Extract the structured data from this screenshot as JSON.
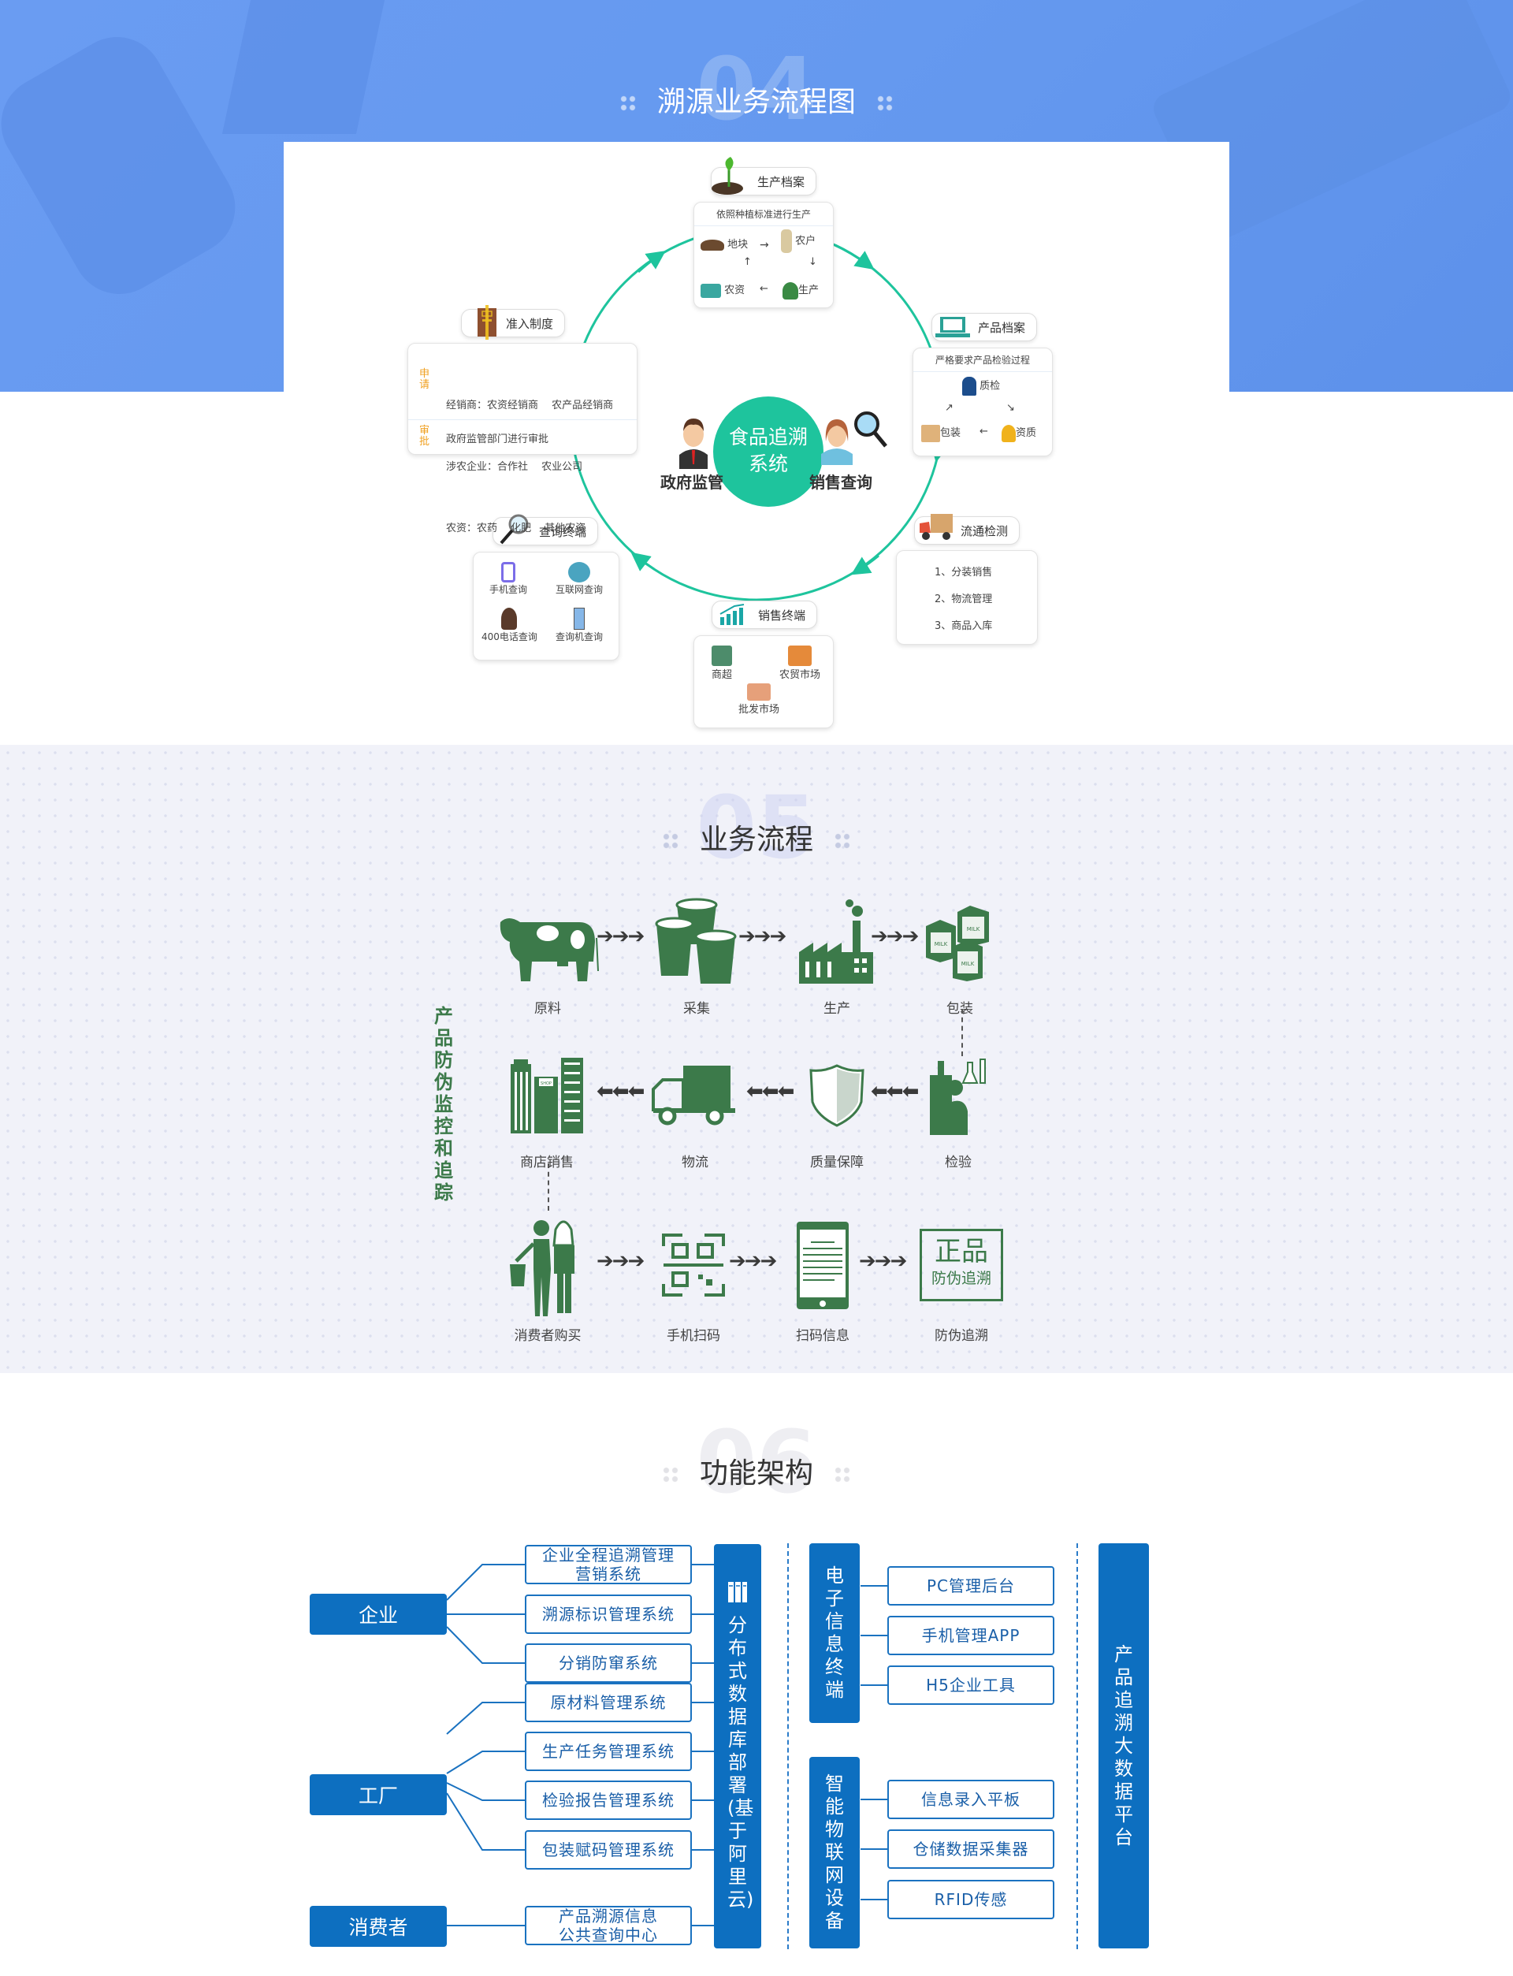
{
  "section1": {
    "number": "04",
    "title": "溯源业务流程图",
    "center": {
      "line1": "食品追溯",
      "line2": "系统"
    },
    "left_person": "政府监管",
    "right_person": "销售查询",
    "colors": {
      "ring": "#1ec49d",
      "accent_orange": "#f0a020"
    },
    "production": {
      "title": "生产档案",
      "header": "依照种植标准进行生产",
      "items": [
        "地块",
        "农户",
        "生产",
        "农资"
      ]
    },
    "product": {
      "title": "产品档案",
      "header": "严格要求产品检验过程",
      "items": [
        "质检",
        "资质",
        "包装"
      ]
    },
    "circulation": {
      "title": "流通检测",
      "items": [
        "1、分装销售",
        "2、物流管理",
        "3、商品入库"
      ]
    },
    "sales": {
      "title": "销售终端",
      "items": [
        "商超",
        "农贸市场",
        "批发市场"
      ]
    },
    "query": {
      "title": "查询终端",
      "items": [
        "手机查询",
        "互联网查询",
        "400电话查询",
        "查询机查询"
      ]
    },
    "access": {
      "title": "准入制度",
      "apply_label": "申请",
      "apply_lines": [
        "经销商：农资经销商　 农产品经销商",
        "涉农企业：合作社　 农业公司",
        "农资：农药　 化肥　 其他农资"
      ],
      "approve_label": "审批",
      "approve_line": "政府监管部门进行审批"
    }
  },
  "section2": {
    "number": "05",
    "title": "业务流程",
    "side_title": "产品防伪监控和追踪",
    "color": "#3c7a4a",
    "row1": [
      "原料",
      "采集",
      "生产",
      "包装"
    ],
    "row2": [
      "商店销售",
      "物流",
      "质量保障",
      "检验"
    ],
    "row3": [
      "消费者购买",
      "手机扫码",
      "扫码信息",
      "防伪追溯"
    ],
    "stamp": {
      "big": "正品",
      "small": "防伪追溯"
    },
    "milk_label": "MILK",
    "shop_label": "SHOP"
  },
  "section3": {
    "number": "06",
    "title": "功能架构",
    "color": "#0d6fc0",
    "actors": [
      "企业",
      "工厂",
      "消费者"
    ],
    "enterprise_systems": [
      "企业全程追溯管理\n营销系统",
      "溯源标识管理系统",
      "分销防窜系统"
    ],
    "factory_systems": [
      "原材料管理系统",
      "生产任务管理系统",
      "检验报告管理系统",
      "包装赋码管理系统"
    ],
    "consumer_systems": [
      "产品溯源信息\n公共查询中心"
    ],
    "database_bar": "分布式数据库部署(基于阿里云)",
    "terminal_bar": "电子信息终端",
    "terminal_items": [
      "PC管理后台",
      "手机管理APP",
      "H5企业工具"
    ],
    "iot_bar": "智能物联网设备",
    "iot_items": [
      "信息录入平板",
      "仓储数据采集器",
      "RFID传感"
    ],
    "platform_bar": "产品追溯大数据平台"
  }
}
